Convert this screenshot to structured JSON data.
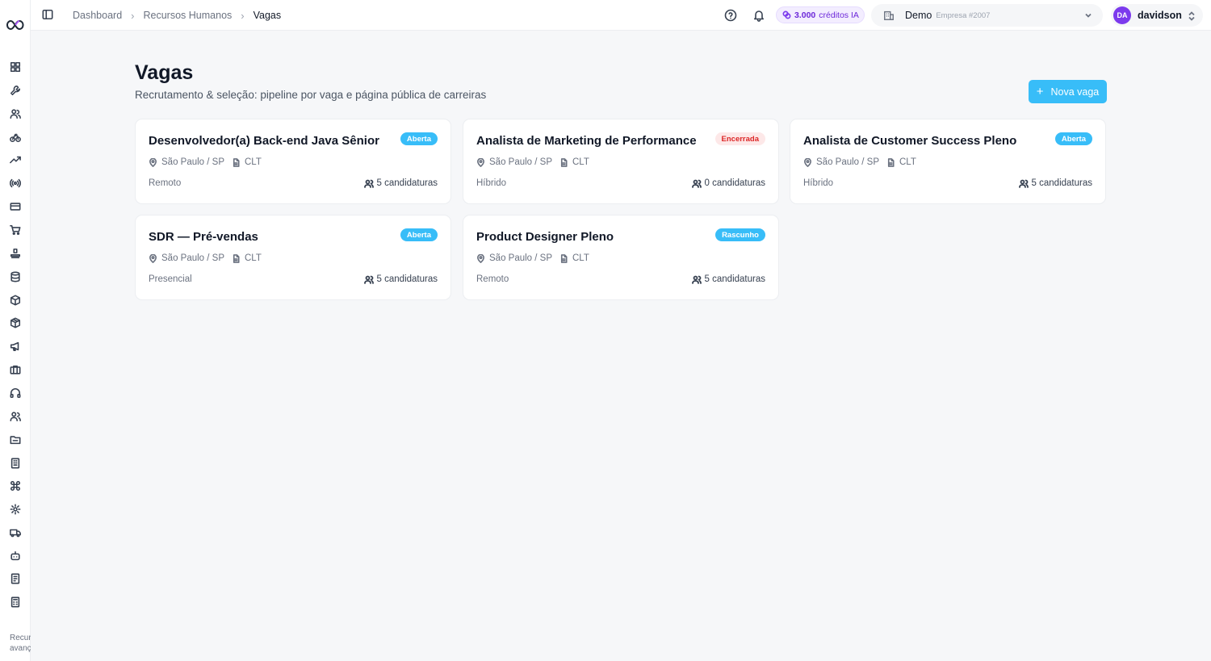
{
  "breadcrumb": {
    "item1": "Dashboard",
    "item2": "Recursos Humanos",
    "current": "Vagas"
  },
  "topbar": {
    "credits_amount": "3.000",
    "credits_label": "créditos IA",
    "company_name": "Demo",
    "company_sub": "Empresa #2007",
    "user_initials": "DA",
    "user_name": "davidson"
  },
  "sidebar": {
    "icons": [
      "grid-icon",
      "wrench-icon",
      "users-icon",
      "bike-icon",
      "trending-up-icon",
      "broadcast-icon",
      "credit-card-icon",
      "cart-icon",
      "stamp-icon",
      "database-icon",
      "box-icon",
      "package-icon",
      "megaphone-icon",
      "briefcase-icon",
      "headphones-icon",
      "user-group-icon",
      "folder-icon",
      "building-icon",
      "command-icon",
      "settings-icon",
      "truck-icon",
      "bot-icon",
      "receipt-icon",
      "calculator-icon"
    ],
    "footer_line1": "Recursos",
    "footer_line2": "avançados"
  },
  "page": {
    "title": "Vagas",
    "subtitle": "Recrutamento & seleção: pipeline por vaga e página pública de carreiras",
    "new_button": "Nova vaga"
  },
  "jobs": [
    {
      "title": "Desenvolvedor(a) Back-end Java Sênior",
      "status": "Aberta",
      "location": "São Paulo / SP",
      "contract": "CLT",
      "mode": "Remoto",
      "applications": "5 candidaturas"
    },
    {
      "title": "Analista de Marketing de Performance",
      "status": "Encerrada",
      "location": "São Paulo / SP",
      "contract": "CLT",
      "mode": "Híbrido",
      "applications": "0 candidaturas"
    },
    {
      "title": "Analista de Customer Success Pleno",
      "status": "Aberta",
      "location": "São Paulo / SP",
      "contract": "CLT",
      "mode": "Híbrido",
      "applications": "5 candidaturas"
    },
    {
      "title": "SDR — Pré-vendas",
      "status": "Aberta",
      "location": "São Paulo / SP",
      "contract": "CLT",
      "mode": "Presencial",
      "applications": "5 candidaturas"
    },
    {
      "title": "Product Designer Pleno",
      "status": "Rascunho",
      "location": "São Paulo / SP",
      "contract": "CLT",
      "mode": "Remoto",
      "applications": "5 candidaturas"
    }
  ],
  "colors": {
    "accent": "#38bdf8",
    "closed_bg": "#fde8e8",
    "closed_text": "#dc2626",
    "avatar": "#7c3aed"
  }
}
